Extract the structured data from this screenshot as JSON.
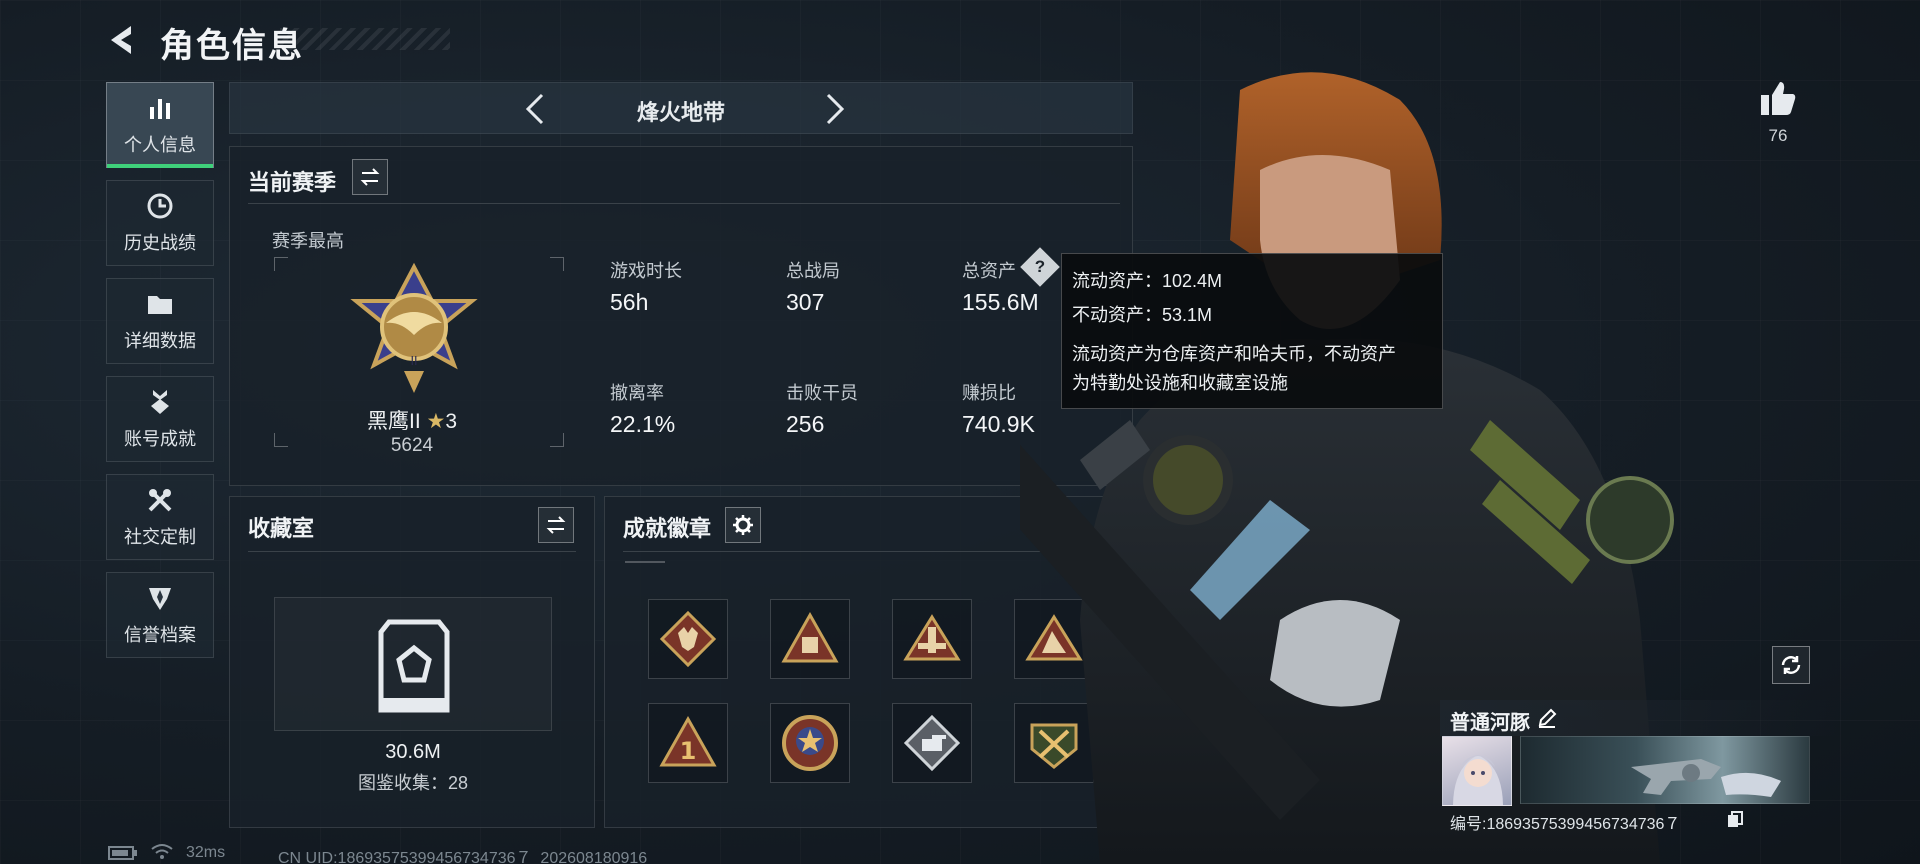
{
  "header": {
    "title": "角色信息"
  },
  "nav": {
    "items": [
      {
        "label": "个人信息",
        "icon": "bar-chart-icon",
        "active": true
      },
      {
        "label": "历史战绩",
        "icon": "clock-icon",
        "active": false
      },
      {
        "label": "详细数据",
        "icon": "folder-icon",
        "active": false
      },
      {
        "label": "账号成就",
        "icon": "medal-icon",
        "active": false
      },
      {
        "label": "社交定制",
        "icon": "tools-icon",
        "active": false
      },
      {
        "label": "信誉档案",
        "icon": "shield-icon",
        "active": false
      }
    ]
  },
  "mode_selector": {
    "name": "烽火地带"
  },
  "season": {
    "title": "当前赛季",
    "highest_label": "赛季最高",
    "rank_name": "黑鹰II",
    "rank_stars": "3",
    "rank_score": "5624",
    "stats": [
      {
        "label": "游戏时长",
        "value": "56h"
      },
      {
        "label": "总战局",
        "value": "307"
      },
      {
        "label": "总资产",
        "value": "155.6M"
      },
      {
        "label": "撤离率",
        "value": "22.1%"
      },
      {
        "label": "击败干员",
        "value": "256"
      },
      {
        "label": "赚损比",
        "value": "740.9K"
      }
    ]
  },
  "tooltip": {
    "liquid": "流动资产：102.4M",
    "fixed": "不动资产：53.1M",
    "desc_line1": "流动资产为仓库资产和哈夫币，不动资产",
    "desc_line2": "为特勤处设施和收藏室设施"
  },
  "collection": {
    "title": "收藏室",
    "value": "30.6M",
    "catalog": "图鉴收集：28"
  },
  "badges": {
    "title": "成就徽章",
    "items": [
      "wolf-badge",
      "wreck-badge",
      "tower-badge",
      "climber-badge",
      "number-one-badge",
      "star-emblem-badge",
      "tank-badge",
      "crossed-guns-badge"
    ]
  },
  "like": {
    "count": "76"
  },
  "profile": {
    "nickname": "普通河豚",
    "id_text": "编号:18693575399456734736７"
  },
  "status": {
    "ping": "32ms",
    "uid": "CN UID:18693575399456734736７_202608180916"
  },
  "colors": {
    "accent_green": "#3fd07a",
    "gold": "#c9a35a",
    "panel_bg": "#18212a"
  }
}
